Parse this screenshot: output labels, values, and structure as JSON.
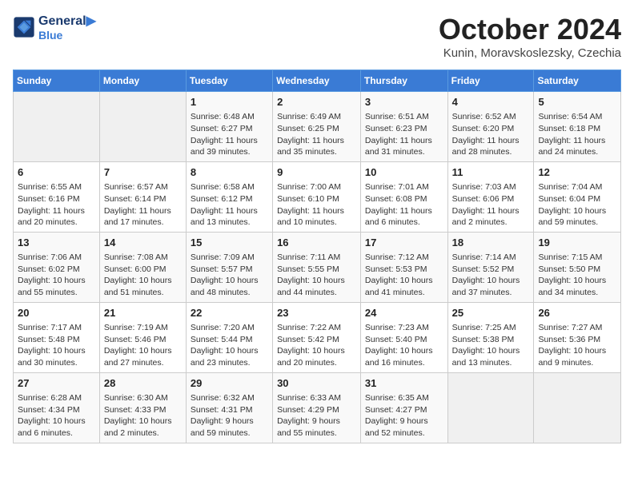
{
  "logo": {
    "line1": "General",
    "line2": "Blue"
  },
  "title": "October 2024",
  "location": "Kunin, Moravskoslezsky, Czechia",
  "days_of_week": [
    "Sunday",
    "Monday",
    "Tuesday",
    "Wednesday",
    "Thursday",
    "Friday",
    "Saturday"
  ],
  "weeks": [
    [
      {
        "day": "",
        "info": ""
      },
      {
        "day": "",
        "info": ""
      },
      {
        "day": "1",
        "info": "Sunrise: 6:48 AM\nSunset: 6:27 PM\nDaylight: 11 hours and 39 minutes."
      },
      {
        "day": "2",
        "info": "Sunrise: 6:49 AM\nSunset: 6:25 PM\nDaylight: 11 hours and 35 minutes."
      },
      {
        "day": "3",
        "info": "Sunrise: 6:51 AM\nSunset: 6:23 PM\nDaylight: 11 hours and 31 minutes."
      },
      {
        "day": "4",
        "info": "Sunrise: 6:52 AM\nSunset: 6:20 PM\nDaylight: 11 hours and 28 minutes."
      },
      {
        "day": "5",
        "info": "Sunrise: 6:54 AM\nSunset: 6:18 PM\nDaylight: 11 hours and 24 minutes."
      }
    ],
    [
      {
        "day": "6",
        "info": "Sunrise: 6:55 AM\nSunset: 6:16 PM\nDaylight: 11 hours and 20 minutes."
      },
      {
        "day": "7",
        "info": "Sunrise: 6:57 AM\nSunset: 6:14 PM\nDaylight: 11 hours and 17 minutes."
      },
      {
        "day": "8",
        "info": "Sunrise: 6:58 AM\nSunset: 6:12 PM\nDaylight: 11 hours and 13 minutes."
      },
      {
        "day": "9",
        "info": "Sunrise: 7:00 AM\nSunset: 6:10 PM\nDaylight: 11 hours and 10 minutes."
      },
      {
        "day": "10",
        "info": "Sunrise: 7:01 AM\nSunset: 6:08 PM\nDaylight: 11 hours and 6 minutes."
      },
      {
        "day": "11",
        "info": "Sunrise: 7:03 AM\nSunset: 6:06 PM\nDaylight: 11 hours and 2 minutes."
      },
      {
        "day": "12",
        "info": "Sunrise: 7:04 AM\nSunset: 6:04 PM\nDaylight: 10 hours and 59 minutes."
      }
    ],
    [
      {
        "day": "13",
        "info": "Sunrise: 7:06 AM\nSunset: 6:02 PM\nDaylight: 10 hours and 55 minutes."
      },
      {
        "day": "14",
        "info": "Sunrise: 7:08 AM\nSunset: 6:00 PM\nDaylight: 10 hours and 51 minutes."
      },
      {
        "day": "15",
        "info": "Sunrise: 7:09 AM\nSunset: 5:57 PM\nDaylight: 10 hours and 48 minutes."
      },
      {
        "day": "16",
        "info": "Sunrise: 7:11 AM\nSunset: 5:55 PM\nDaylight: 10 hours and 44 minutes."
      },
      {
        "day": "17",
        "info": "Sunrise: 7:12 AM\nSunset: 5:53 PM\nDaylight: 10 hours and 41 minutes."
      },
      {
        "day": "18",
        "info": "Sunrise: 7:14 AM\nSunset: 5:52 PM\nDaylight: 10 hours and 37 minutes."
      },
      {
        "day": "19",
        "info": "Sunrise: 7:15 AM\nSunset: 5:50 PM\nDaylight: 10 hours and 34 minutes."
      }
    ],
    [
      {
        "day": "20",
        "info": "Sunrise: 7:17 AM\nSunset: 5:48 PM\nDaylight: 10 hours and 30 minutes."
      },
      {
        "day": "21",
        "info": "Sunrise: 7:19 AM\nSunset: 5:46 PM\nDaylight: 10 hours and 27 minutes."
      },
      {
        "day": "22",
        "info": "Sunrise: 7:20 AM\nSunset: 5:44 PM\nDaylight: 10 hours and 23 minutes."
      },
      {
        "day": "23",
        "info": "Sunrise: 7:22 AM\nSunset: 5:42 PM\nDaylight: 10 hours and 20 minutes."
      },
      {
        "day": "24",
        "info": "Sunrise: 7:23 AM\nSunset: 5:40 PM\nDaylight: 10 hours and 16 minutes."
      },
      {
        "day": "25",
        "info": "Sunrise: 7:25 AM\nSunset: 5:38 PM\nDaylight: 10 hours and 13 minutes."
      },
      {
        "day": "26",
        "info": "Sunrise: 7:27 AM\nSunset: 5:36 PM\nDaylight: 10 hours and 9 minutes."
      }
    ],
    [
      {
        "day": "27",
        "info": "Sunrise: 6:28 AM\nSunset: 4:34 PM\nDaylight: 10 hours and 6 minutes."
      },
      {
        "day": "28",
        "info": "Sunrise: 6:30 AM\nSunset: 4:33 PM\nDaylight: 10 hours and 2 minutes."
      },
      {
        "day": "29",
        "info": "Sunrise: 6:32 AM\nSunset: 4:31 PM\nDaylight: 9 hours and 59 minutes."
      },
      {
        "day": "30",
        "info": "Sunrise: 6:33 AM\nSunset: 4:29 PM\nDaylight: 9 hours and 55 minutes."
      },
      {
        "day": "31",
        "info": "Sunrise: 6:35 AM\nSunset: 4:27 PM\nDaylight: 9 hours and 52 minutes."
      },
      {
        "day": "",
        "info": ""
      },
      {
        "day": "",
        "info": ""
      }
    ]
  ]
}
